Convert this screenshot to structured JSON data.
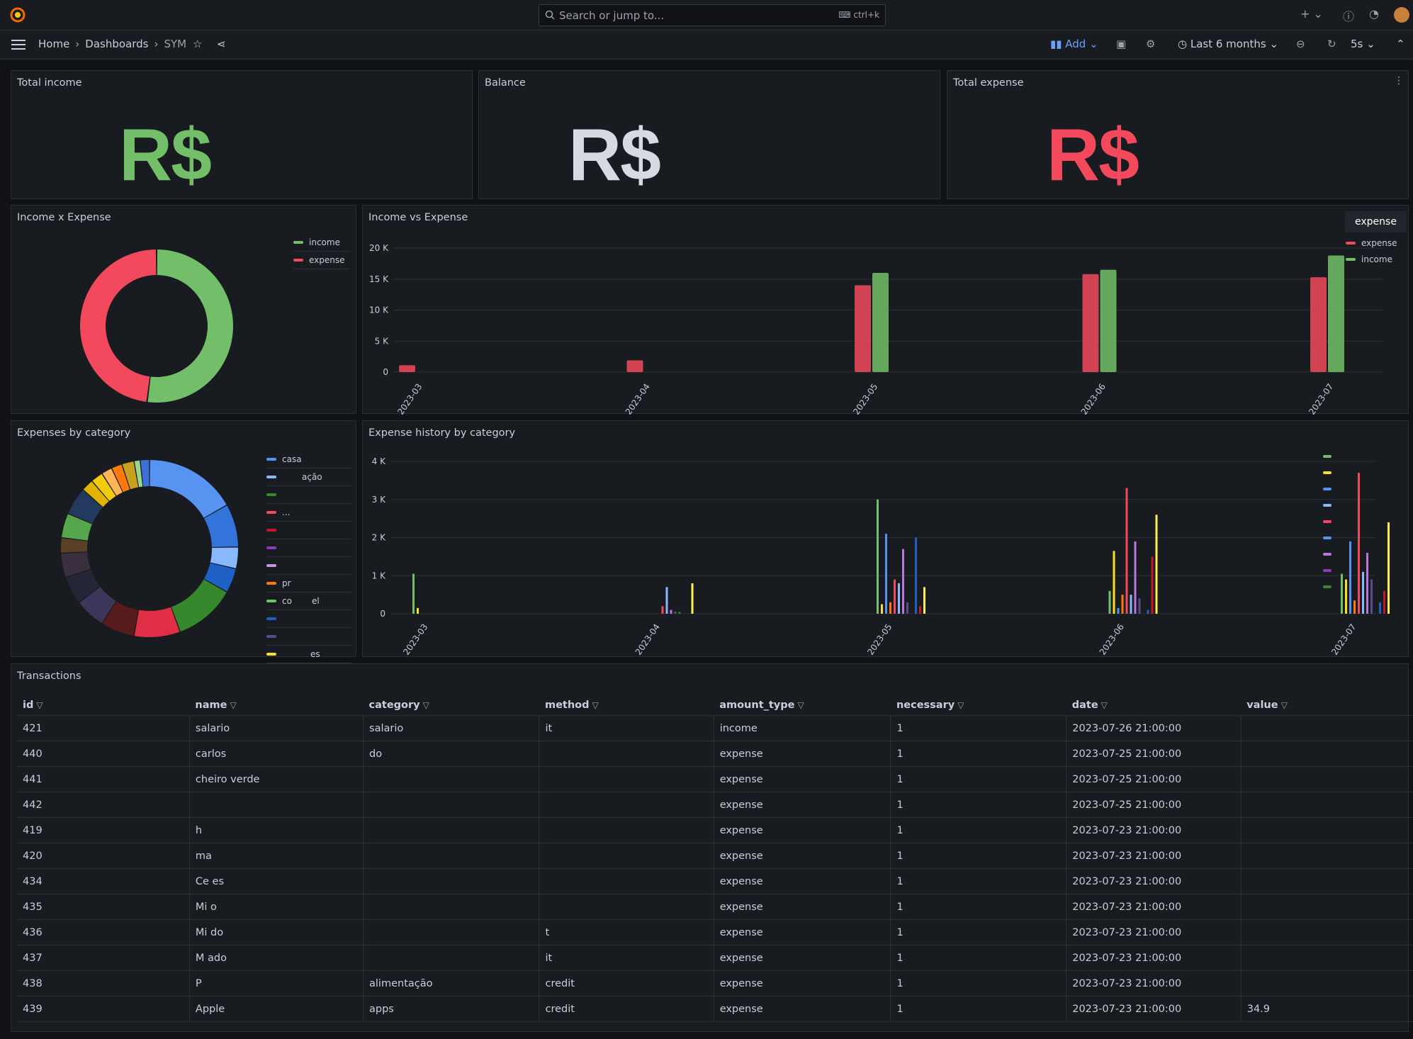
{
  "topbar": {
    "search_placeholder": "Search or jump to...",
    "shortcut": "ctrl+k"
  },
  "breadcrumb": {
    "home": "Home",
    "dashboards": "Dashboards",
    "current": "SYM"
  },
  "toolbar": {
    "add_label": "Add",
    "time_range": "Last 6 months",
    "refresh_interval": "5s"
  },
  "colors": {
    "income": "#73bf69",
    "expense": "#f2495c",
    "balance": "#d8d9e3",
    "accent": "#6e9fff"
  },
  "stats": [
    {
      "title": "Total income",
      "prefix": "R$"
    },
    {
      "title": "Balance",
      "prefix": "R$"
    },
    {
      "title": "Total expense",
      "prefix": "R$"
    }
  ],
  "panels": {
    "income_expense_pie": "Income x Expense",
    "income_vs_expense": "Income vs Expense",
    "expenses_by_category": "Expenses by category",
    "expense_history": "Expense history by category",
    "transactions": "Transactions"
  },
  "tooltip": {
    "label": "expense"
  },
  "category_legend": [
    "casa",
    "ação",
    "...",
    "pr",
    "co",
    "el",
    "es"
  ],
  "chart_data": [
    {
      "type": "pie",
      "title": "Income x Expense",
      "legend": [
        "income",
        "expense"
      ],
      "values": [
        52,
        48
      ]
    },
    {
      "type": "bar",
      "title": "Income vs Expense",
      "categories": [
        "2023-03",
        "2023-04",
        "2023-05",
        "2023-06",
        "2023-07"
      ],
      "series": [
        {
          "name": "expense",
          "values": [
            1100,
            1900,
            14000,
            15800,
            15300
          ]
        },
        {
          "name": "income",
          "values": [
            0,
            0,
            16000,
            16500,
            18800
          ]
        }
      ],
      "yticks": [
        "0",
        "5 K",
        "10 K",
        "15 K",
        "20 K"
      ],
      "ylim": [
        0,
        20000
      ],
      "legend": "top-right"
    },
    {
      "type": "pie",
      "title": "Expenses by category",
      "legend": [
        "casa",
        "ação"
      ]
    },
    {
      "type": "bar",
      "title": "Expense history by category",
      "categories": [
        "2023-03",
        "2023-04",
        "2023-05",
        "2023-06",
        "2023-07"
      ],
      "yticks": [
        "0",
        "1 K",
        "2 K",
        "3 K",
        "4 K"
      ],
      "ylim": [
        0,
        4000
      ],
      "legend": "right"
    }
  ],
  "table": {
    "columns": [
      "id",
      "name",
      "category",
      "method",
      "amount_type",
      "necessary",
      "date",
      "value"
    ],
    "rows": [
      [
        "421",
        "salario",
        "salario",
        "it",
        "income",
        "1",
        "2023-07-26 21:00:00",
        ""
      ],
      [
        "440",
        "carlos",
        "do",
        "",
        "expense",
        "1",
        "2023-07-25 21:00:00",
        ""
      ],
      [
        "441",
        "cheiro verde",
        "",
        "",
        "expense",
        "1",
        "2023-07-25 21:00:00",
        ""
      ],
      [
        "442",
        "",
        "",
        "",
        "expense",
        "1",
        "2023-07-25 21:00:00",
        ""
      ],
      [
        "419",
        "h",
        "",
        "",
        "expense",
        "1",
        "2023-07-23 21:00:00",
        ""
      ],
      [
        "420",
        "ma",
        "",
        "",
        "expense",
        "1",
        "2023-07-23 21:00:00",
        ""
      ],
      [
        "434",
        "Ce          es",
        "",
        "",
        "expense",
        "1",
        "2023-07-23 21:00:00",
        ""
      ],
      [
        "435",
        "Mi          o",
        "",
        "",
        "expense",
        "1",
        "2023-07-23 21:00:00",
        ""
      ],
      [
        "436",
        "Mi          do",
        "",
        "t",
        "expense",
        "1",
        "2023-07-23 21:00:00",
        ""
      ],
      [
        "437",
        "M          ado",
        "",
        "it",
        "expense",
        "1",
        "2023-07-23 21:00:00",
        ""
      ],
      [
        "438",
        "P",
        "alimentação",
        "credit",
        "expense",
        "1",
        "2023-07-23 21:00:00",
        ""
      ],
      [
        "439",
        "Apple",
        "apps",
        "credit",
        "expense",
        "1",
        "2023-07-23 21:00:00",
        "34.9"
      ]
    ]
  }
}
